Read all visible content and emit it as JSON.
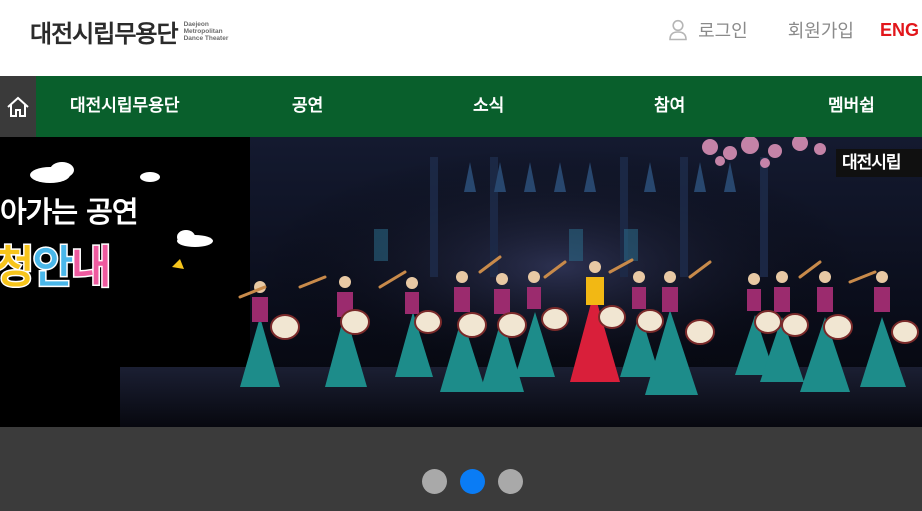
{
  "header": {
    "logo_ko": "대전시립무용단",
    "logo_en": [
      "Daejeon",
      "Metropolitan",
      "Dance Theater"
    ],
    "login": "로그인",
    "join": "회원가입",
    "eng": "ENG",
    "login_icon": "user-icon"
  },
  "nav": {
    "home_icon": "home-icon",
    "items": [
      "대전시립무용단",
      "공연",
      "소식",
      "참여",
      "멤버쉽"
    ]
  },
  "banner": {
    "line1": "아가는 공연",
    "line2": [
      "청",
      "안",
      "내"
    ],
    "corner_logo": "대전시립",
    "colors": {
      "yellow": "#f7c51c",
      "blue": "#4ab7ea",
      "pink": "#ee5a9f"
    }
  },
  "slider": {
    "dots": 3,
    "active_index": 1
  },
  "colors": {
    "nav_green": "#095f2c",
    "home_bg": "#3a3a3a",
    "eng_red": "#e2161b",
    "dot_active": "#0a7cf5",
    "dot_inactive": "#a9a9a9"
  }
}
